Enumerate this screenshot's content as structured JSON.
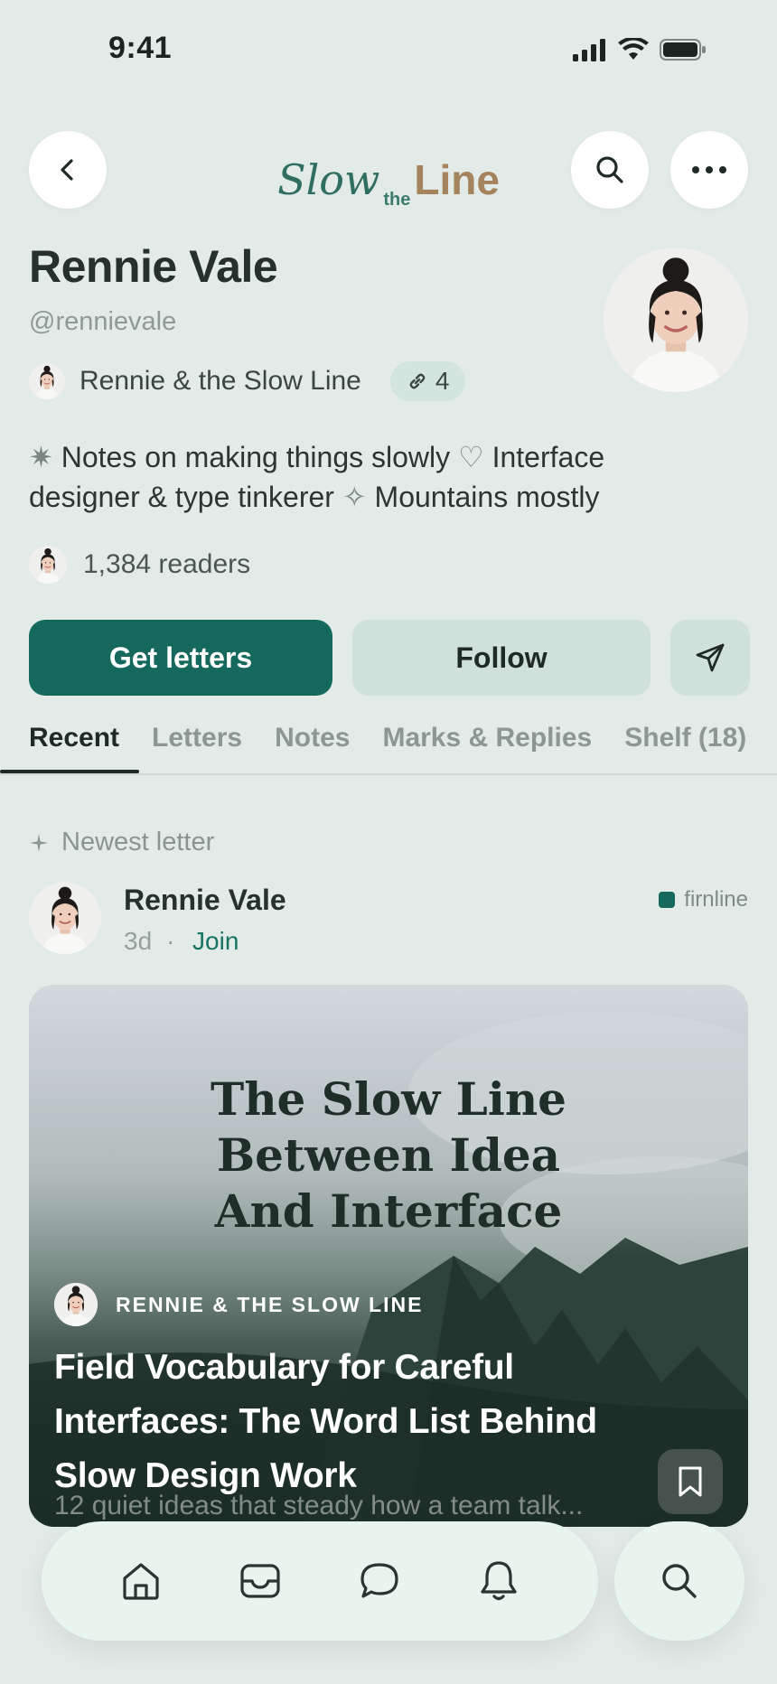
{
  "status_bar": {
    "time": "9:41"
  },
  "header": {
    "logo": {
      "slow": "Slow",
      "the": "the",
      "line": "Line"
    }
  },
  "profile": {
    "name": "Rennie Vale",
    "handle": "@rennievale",
    "publication": "Rennie & the Slow Line",
    "link_count": "4",
    "bio_line1_pre": "✷",
    "bio_line1_text": " Notes on making things slowly ",
    "bio_heart": "♡",
    "bio_line1_end": " Interface",
    "bio_line2_text": "designer & type tinkerer ",
    "bio_sparkle": "✧",
    "bio_line2_end": " Mountains mostly",
    "readers": "1,384 readers"
  },
  "actions": {
    "primary_label": "Get letters",
    "secondary_label": "Follow"
  },
  "tabs": [
    {
      "label": "Recent",
      "active": true
    },
    {
      "label": "Letters"
    },
    {
      "label": "Notes"
    },
    {
      "label": "Marks & Replies"
    },
    {
      "label": "Shelf (18)"
    }
  ],
  "feed": {
    "section_label": "Newest letter",
    "author": "Rennie Vale",
    "age": "3d",
    "separator": "·",
    "join_label": "Join",
    "tag": "firnline",
    "card": {
      "cover_title_line1": "The Slow Line",
      "cover_title_line2": "Between Idea",
      "cover_title_line3": "And Interface",
      "publication": "RENNIE & THE SLOW LINE",
      "headline_line1": "Field Vocabulary for Careful",
      "headline_line2": "Interfaces: The Word List Behind",
      "headline_line3": "Slow Design Work",
      "subtitle": "12 quiet ideas that steady how a team talk..."
    }
  },
  "colors": {
    "accent": "#15695c",
    "background": "#e3ebe8",
    "logo_green": "#2f6e60",
    "logo_gold": "#a5835c"
  }
}
